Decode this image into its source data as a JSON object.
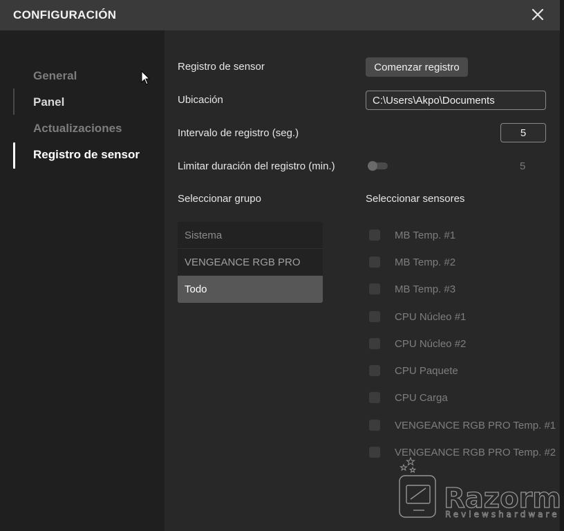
{
  "window": {
    "title": "CONFIGURACIÓN"
  },
  "sidebar": {
    "items": [
      {
        "label": "General"
      },
      {
        "label": "Panel"
      },
      {
        "label": "Actualizaciones"
      },
      {
        "label": "Registro de sensor"
      }
    ],
    "active": "Registro de sensor"
  },
  "settings": {
    "sensor_log_label": "Registro de sensor",
    "start_log_button": "Comenzar registro",
    "location_label": "Ubicación",
    "location_value": "C:\\Users\\Akpo\\Documents",
    "interval_label": "Intervalo de registro (seg.)",
    "interval_value": "5",
    "limit_label": "Limitar duración del registro (min.)",
    "limit_value": "5",
    "limit_enabled": false
  },
  "groups": {
    "title": "Seleccionar grupo",
    "items": [
      "Sistema",
      "VENGEANCE RGB PRO",
      "Todo"
    ],
    "selected": "Todo"
  },
  "sensors": {
    "title": "Seleccionar sensores",
    "items": [
      {
        "label": "MB Temp. #1",
        "checked": false
      },
      {
        "label": "MB Temp. #2",
        "checked": false
      },
      {
        "label": "MB Temp. #3",
        "checked": false
      },
      {
        "label": "CPU Núcleo #1",
        "checked": false
      },
      {
        "label": "CPU Núcleo #2",
        "checked": false
      },
      {
        "label": "CPU Paquete",
        "checked": false
      },
      {
        "label": "CPU Carga",
        "checked": false
      },
      {
        "label": "VENGEANCE RGB PRO Temp. #1",
        "checked": false
      },
      {
        "label": "VENGEANCE RGB PRO Temp. #2",
        "checked": false
      }
    ]
  },
  "watermark": {
    "brand": "Razorman",
    "tagline": "Reviewshardware"
  },
  "colors": {
    "background": "#1f1f1f",
    "panel": "#282828",
    "titlebar": "#3a3a3a",
    "selected": "#575757"
  }
}
